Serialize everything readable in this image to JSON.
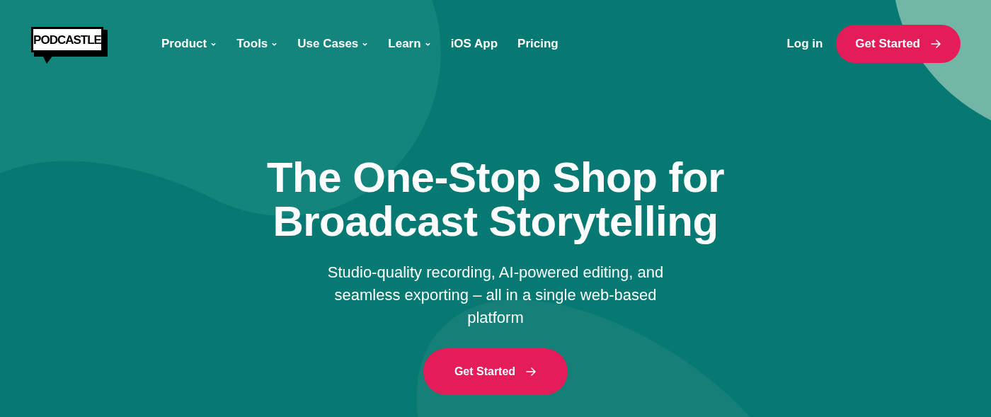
{
  "logo": {
    "text": "PODCASTLE"
  },
  "nav": [
    {
      "label": "Product",
      "dropdown": true
    },
    {
      "label": "Tools",
      "dropdown": true
    },
    {
      "label": "Use Cases",
      "dropdown": true
    },
    {
      "label": "Learn",
      "dropdown": true
    },
    {
      "label": "iOS App",
      "dropdown": false
    },
    {
      "label": "Pricing",
      "dropdown": false
    }
  ],
  "login": "Log in",
  "header_cta": "Get Started",
  "hero": {
    "title_lines": [
      "The One-Stop Shop for",
      "Broadcast Storytelling"
    ],
    "subtitle": "Studio-quality recording, AI-powered editing, and seamless exporting – all in a single web-based platform",
    "cta": "Get Started"
  }
}
